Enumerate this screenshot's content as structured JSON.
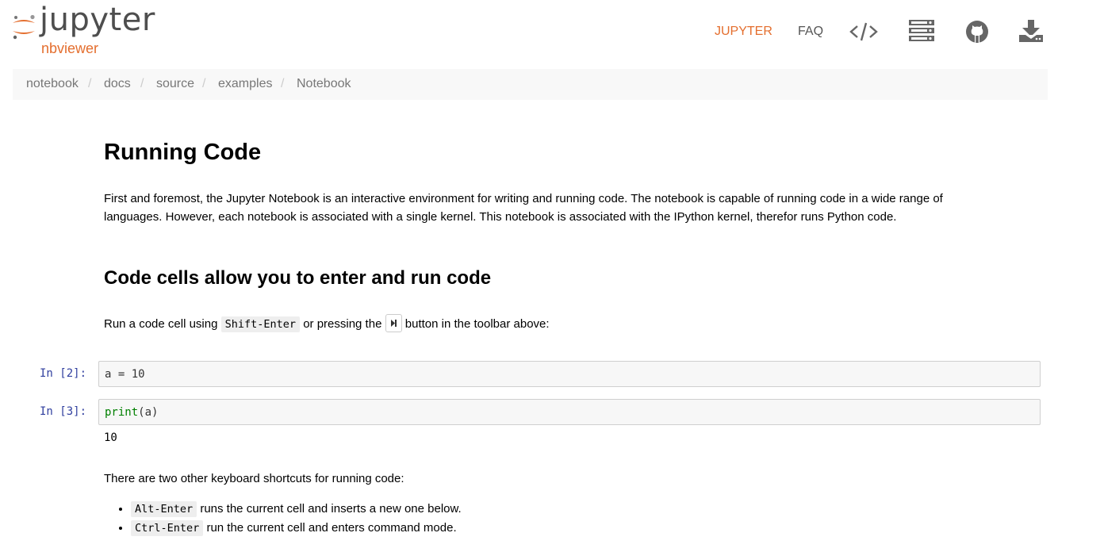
{
  "header": {
    "logo": {
      "wordmark": "jupyter",
      "subtitle": "nbviewer"
    },
    "nav": {
      "jupyter_label": "JUPYTER",
      "faq_label": "FAQ",
      "icons": [
        "code-icon",
        "server-icon",
        "github-icon",
        "download-icon"
      ]
    },
    "colors": {
      "accent": "#e46e2e",
      "prompt": "#303f9f"
    }
  },
  "breadcrumb": {
    "items": [
      "notebook",
      "docs",
      "source",
      "examples",
      "Notebook"
    ],
    "separator": "/"
  },
  "notebook": {
    "title": "Running Code",
    "intro_line1": "First and foremost, the Jupyter Notebook is an interactive environment for writing and running code. The notebook is capable of running code in a wide range of",
    "intro_line2": "languages. However, each notebook is associated with a single kernel. This notebook is associated with the IPython kernel, therefor runs Python code.",
    "section_title": "Code cells allow you to enter and run code",
    "run_text_before": "Run a code cell using",
    "run_shortcut": "Shift-Enter",
    "run_text_middle": "or pressing the",
    "run_text_after": "button in the toolbar above:",
    "cells": [
      {
        "prompt": "In [2]:",
        "code": "a = 10"
      },
      {
        "prompt": "In [3]:",
        "code_fn": "print",
        "code_rest": "(a)",
        "output": "10"
      }
    ],
    "shortcuts_intro": "There are two other keyboard shortcuts for running code:",
    "shortcuts": [
      {
        "key": "Alt-Enter",
        "text": "runs the current cell and inserts a new one below."
      },
      {
        "key": "Ctrl-Enter",
        "text": "run the current cell and enters command mode."
      }
    ]
  }
}
